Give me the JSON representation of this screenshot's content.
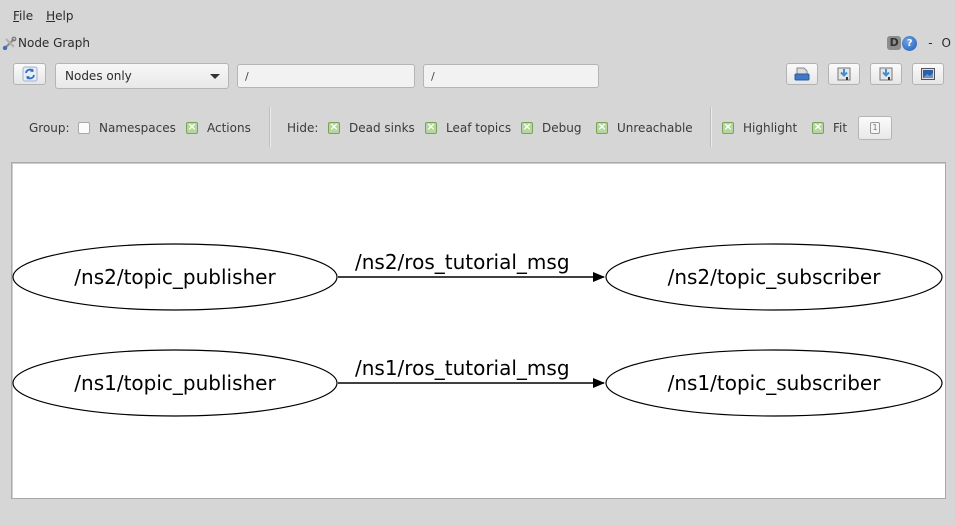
{
  "menu": {
    "items": [
      {
        "label": "File",
        "mnemonic": "F",
        "rest": "ile"
      },
      {
        "label": "Help",
        "mnemonic": "H",
        "rest": "elp"
      }
    ]
  },
  "titlebar": {
    "icon": "tools-icon",
    "title": "Node Graph",
    "badge": "D",
    "help_glyph": "?",
    "minimize": "-",
    "restore": "O"
  },
  "toolbar": {
    "refresh_icon": "refresh-icon",
    "graph_type": "Nodes only",
    "node_filter": "/",
    "topic_filter": "/",
    "right_buttons": [
      {
        "name": "load-dot-button",
        "icon": "open-file-icon"
      },
      {
        "name": "save-dot-button",
        "icon": "save-dot-icon"
      },
      {
        "name": "save-svg-button",
        "icon": "save-svg-icon"
      },
      {
        "name": "save-image-button",
        "icon": "image-icon"
      }
    ]
  },
  "options": {
    "group_label": "Group:",
    "group": [
      {
        "label": "Namespaces",
        "checked": false
      },
      {
        "label": "Actions",
        "checked": true
      }
    ],
    "hide_label": "Hide:",
    "hide": [
      {
        "label": "Dead sinks",
        "checked": true
      },
      {
        "label": "Leaf topics",
        "checked": true
      },
      {
        "label": "Debug",
        "checked": true
      },
      {
        "label": "Unreachable",
        "checked": true
      }
    ],
    "view": [
      {
        "label": "Highlight",
        "checked": true
      },
      {
        "label": "Fit",
        "checked": true
      }
    ]
  },
  "graph": {
    "nodes": [
      {
        "id": "ns2_pub",
        "label": "/ns2/topic_publisher"
      },
      {
        "id": "ns2_sub",
        "label": "/ns2/topic_subscriber"
      },
      {
        "id": "ns1_pub",
        "label": "/ns1/topic_publisher"
      },
      {
        "id": "ns1_sub",
        "label": "/ns1/topic_subscriber"
      }
    ],
    "edges": [
      {
        "from": "ns2_pub",
        "to": "ns2_sub",
        "label": "/ns2/ros_tutorial_msg"
      },
      {
        "from": "ns1_pub",
        "to": "ns1_sub",
        "label": "/ns1/ros_tutorial_msg"
      }
    ]
  }
}
